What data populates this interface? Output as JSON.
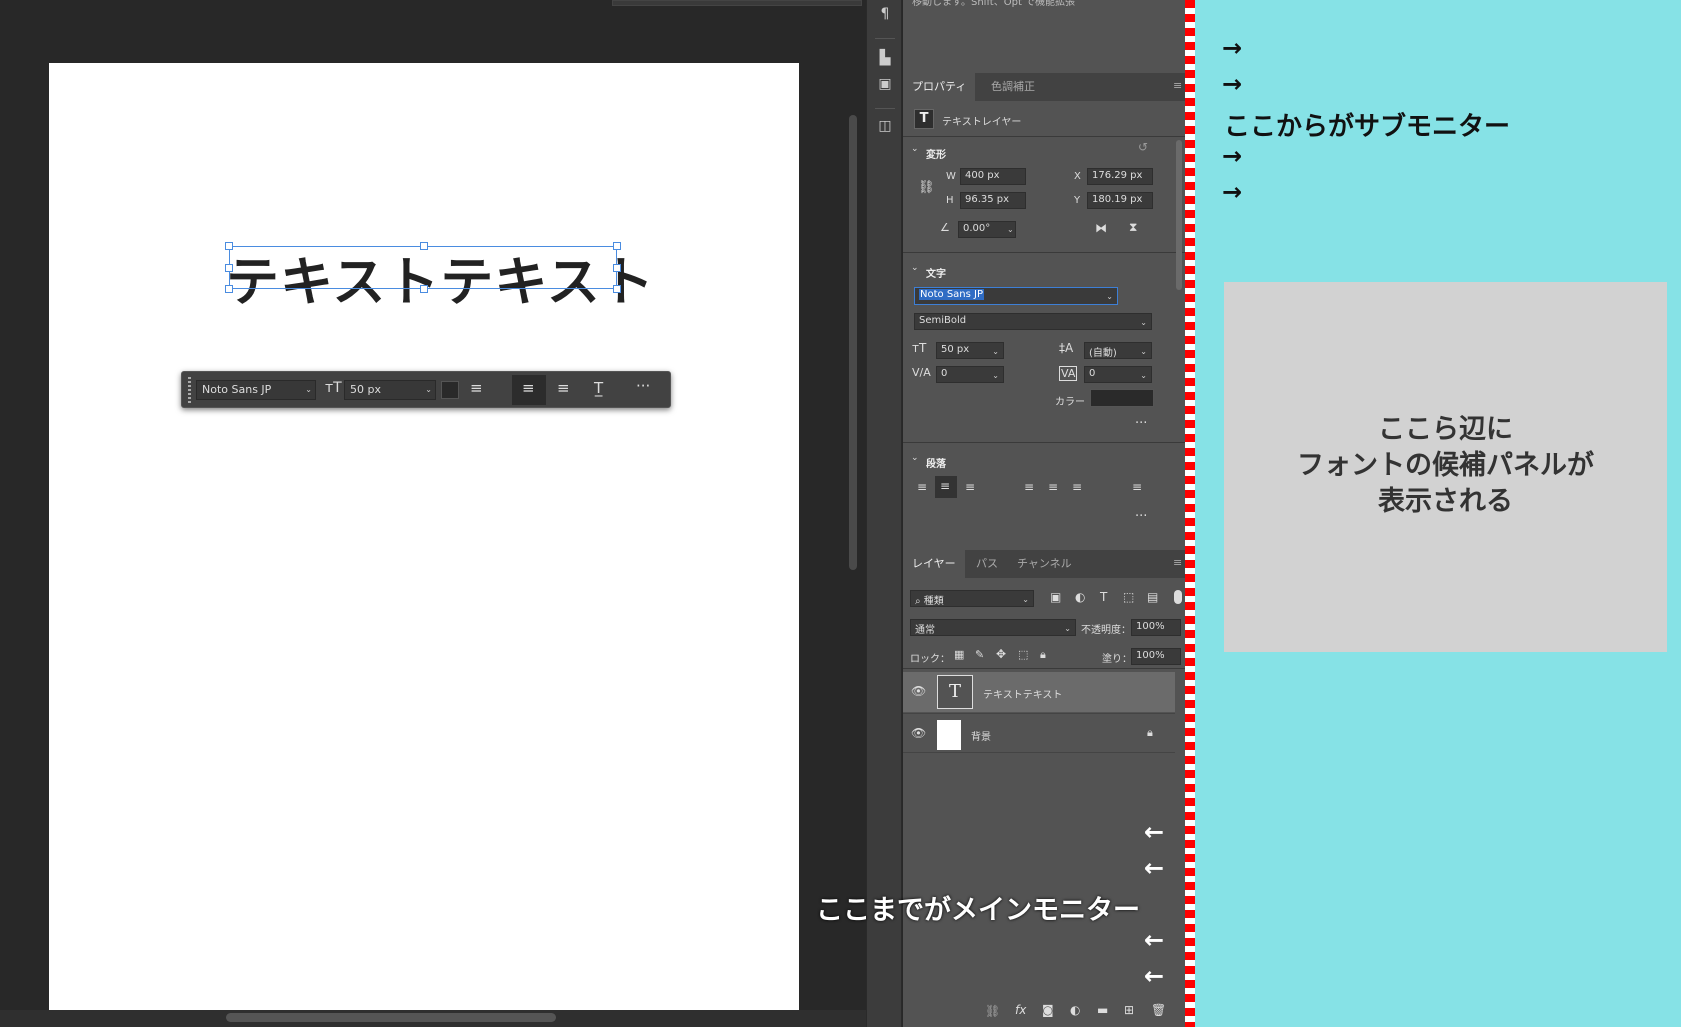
{
  "canvas": {
    "text": "テキストテキスト",
    "hint_text": "移動します。Shift、Opt で機能拡張"
  },
  "taskbar": {
    "font": "Noto Sans JP",
    "size": "50 px",
    "more": "···"
  },
  "properties": {
    "tabs": [
      "プロパティ",
      "色調補正"
    ],
    "layer_type": "テキストレイヤー",
    "transform": {
      "title": "変形",
      "w_label": "W",
      "w": "400 px",
      "h_label": "H",
      "h": "96.35 px",
      "x_label": "X",
      "x": "176.29 px",
      "y_label": "Y",
      "y": "180.19 px",
      "angle": "0.00°"
    },
    "character": {
      "title": "文字",
      "font": "Noto Sans JP",
      "style": "SemiBold",
      "size": "50 px",
      "leading": "(自動)",
      "kerning": "0",
      "tracking": "0",
      "color_label": "カラー"
    },
    "paragraph": {
      "title": "段落"
    },
    "more": "···"
  },
  "layers": {
    "tabs": [
      "レイヤー",
      "パス",
      "チャンネル"
    ],
    "filter": "種類",
    "blend": "通常",
    "opacity_label": "不透明度：",
    "opacity": "100%",
    "lock_label": "ロック：",
    "fill_label": "塗り：",
    "fill": "100%",
    "items": [
      {
        "name": "テキストテキスト",
        "thumb": "T"
      },
      {
        "name": "背景",
        "thumb": ""
      }
    ]
  },
  "annotations": {
    "sub_monitor": "ここからがサブモニター",
    "main_monitor": "ここまでがメインモニター",
    "sub_box_line1": "ここら辺に",
    "sub_box_line2": "フォントの候補パネルが",
    "sub_box_line3": "表示される",
    "right_arrow": "→",
    "left_arrow": "←"
  },
  "colors": {
    "sub_monitor_bg": "#86e2e6",
    "boundary": "#ff0000",
    "selection": "#4a8ce0"
  }
}
